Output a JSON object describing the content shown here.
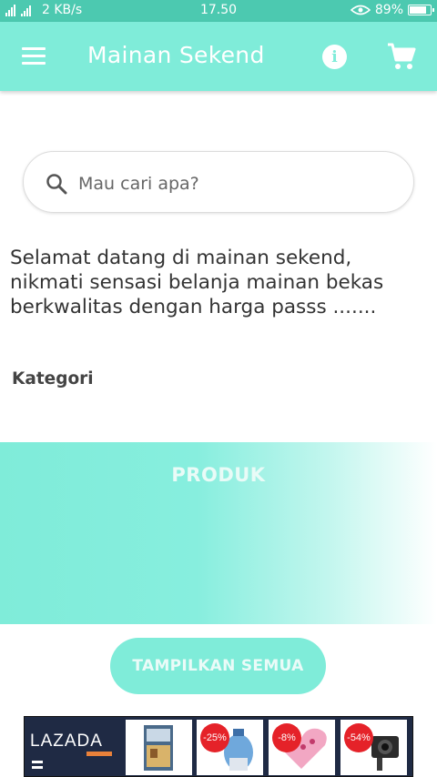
{
  "status_bar": {
    "network": "2 KB/s",
    "time": "17.50",
    "battery": "89%",
    "battery_level": 0.89
  },
  "app_bar": {
    "title": "Mainan Sekend",
    "menu_icon": "menu-icon",
    "info_icon": "info-icon",
    "cart_icon": "cart-icon"
  },
  "search": {
    "placeholder": "Mau cari apa?",
    "value": ""
  },
  "welcome_text": "Selamat datang di mainan sekend, nikmati sensasi belanja mainan bekas berkwalitas dengan harga passs .......",
  "kategori_label": "Kategori",
  "produk_label": "PRODUK",
  "show_all_label": "TAMPILKAN SEMUA",
  "ad": {
    "brand": "LAZADA",
    "tiles": [
      {
        "badge": ""
      },
      {
        "badge": "-25%"
      },
      {
        "badge": "-8%"
      },
      {
        "badge": "-54%"
      }
    ]
  },
  "colors": {
    "status_bar": "#4cc9b0",
    "accent": "#7fecd9",
    "ad_background": "#1f2a44",
    "ad_badge": "#e52229"
  }
}
